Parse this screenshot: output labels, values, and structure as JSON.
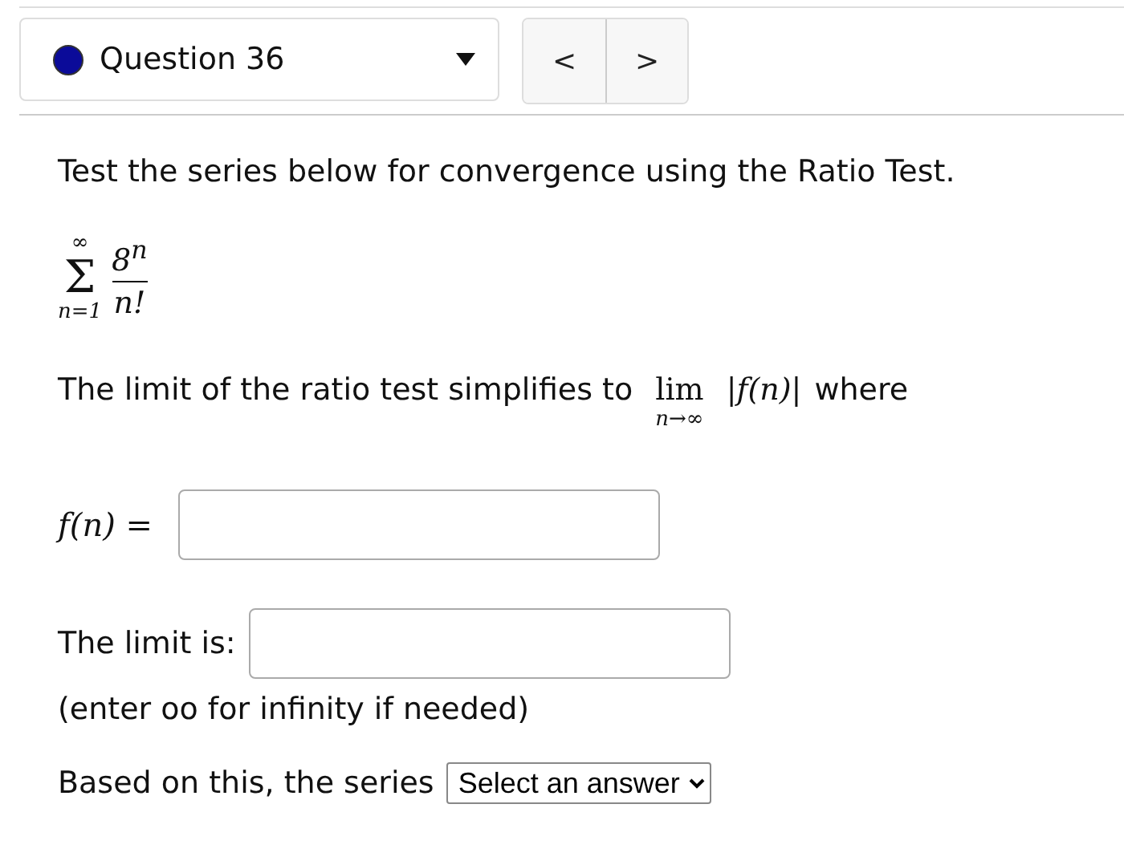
{
  "question_nav": {
    "title": "Question 36",
    "color": "#0b0b99",
    "prev_label": "<",
    "next_label": ">"
  },
  "prompt": "Test the series below for convergence using the Ratio Test.",
  "series": {
    "sigma": "Σ",
    "upper": "∞",
    "lower": "n=1",
    "numerator": "8$^{n}$",
    "denominator": "n!"
  },
  "limit_line": {
    "text": "The limit of the ratio test simplifies to",
    "lim": "lim",
    "lim_sub": "n→∞",
    "expr": "|f(n)|",
    "tail": "where"
  },
  "fn_label": "f(n) =",
  "limit_label": "The limit is:",
  "hint": "(enter oo for infinity if needed)",
  "conclusion": {
    "text": "Based on this, the series",
    "select": "Select an answer"
  }
}
